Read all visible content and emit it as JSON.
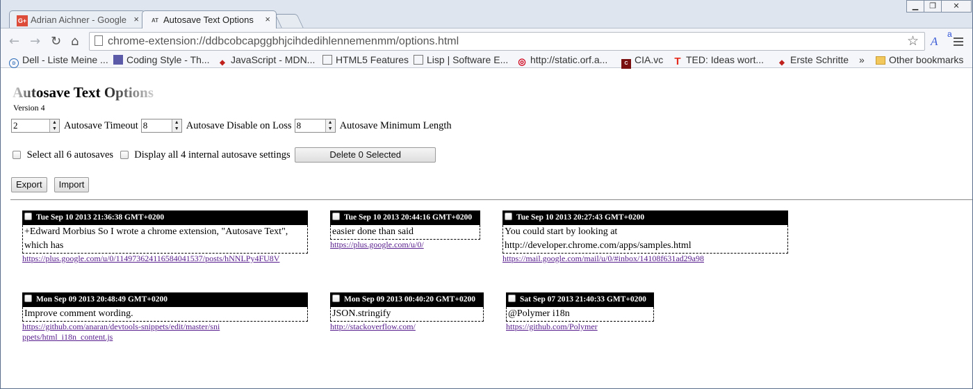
{
  "browser": {
    "tabs": [
      {
        "title": "Adrian Aichner - Google",
        "favicon": "G+",
        "color": "#dd4b39"
      },
      {
        "title": "Autosave Text Options",
        "favicon": "AT",
        "color": "#ffffff"
      }
    ],
    "close_glyph": "×",
    "url": "chrome-extension://ddbcobcapggbhjcihdedihlennemenmm/options.html",
    "bookmarks": [
      {
        "label": "Dell - Liste Meine ...",
        "icon": "dell-icon"
      },
      {
        "label": "Coding Style - Th...",
        "icon": "book-icon"
      },
      {
        "label": "JavaScript - MDN...",
        "icon": "mozilla-dino-icon"
      },
      {
        "label": "HTML5 Features",
        "icon": "page-icon"
      },
      {
        "label": "Lisp | Software E...",
        "icon": "page-icon"
      },
      {
        "label": "http://static.orf.a...",
        "icon": "target-icon"
      },
      {
        "label": "CIA.vc",
        "icon": "cia-icon"
      },
      {
        "label": "TED: Ideas wort...",
        "icon": "ted-icon"
      },
      {
        "label": "Erste Schritte",
        "icon": "mozilla-dino-icon"
      }
    ],
    "overflow_glyph": "»",
    "other_bookmarks": "Other bookmarks"
  },
  "page": {
    "title": "Autosave Text Options",
    "version": "Version 4",
    "settings": [
      {
        "value": "2",
        "label": "Autosave Timeout"
      },
      {
        "value": "8",
        "label": "Autosave Disable on Loss"
      },
      {
        "value": "8",
        "label": "Autosave Minimum Length"
      }
    ],
    "select_all_label": "Select all 6 autosaves",
    "display_all_label": "Display all 4 internal autosave settings",
    "delete_label": "Delete 0 Selected",
    "export_label": "Export",
    "import_label": "Import"
  },
  "autosaves": [
    {
      "date": "Tue Sep 10 2013 21:36:38 GMT+0200",
      "text": "+Edward Morbius So I wrote a chrome extension, \"Autosave Text\", which has",
      "url": "https://plus.google.com/u/0/114973624116584041537/posts/hNNLPy4FU8V"
    },
    {
      "date": "Tue Sep 10 2013 20:44:16 GMT+0200",
      "text": "easier done than said",
      "url": "https://plus.google.com/u/0/"
    },
    {
      "date": "Tue Sep 10 2013 20:27:43 GMT+0200",
      "text": "You could start by looking at http://developer.chrome.com/apps/samples.html",
      "url": "https://mail.google.com/mail/u/0/#inbox/14108f631ad29a98"
    },
    {
      "date": "Mon Sep 09 2013 20:48:49 GMT+0200",
      "text": "Improve comment wording.",
      "url": "https://github.com/anaran/devtools-snippets/edit/master/snippets/html_i18n_content.js"
    },
    {
      "date": "Mon Sep 09 2013 00:40:20 GMT+0200",
      "text": "JSON.stringify",
      "url": "http://stackoverflow.com/"
    },
    {
      "date": "Sat Sep 07 2013 21:40:33 GMT+0200",
      "text": "@Polymer i18n",
      "url": "https://github.com/Polymer"
    }
  ]
}
